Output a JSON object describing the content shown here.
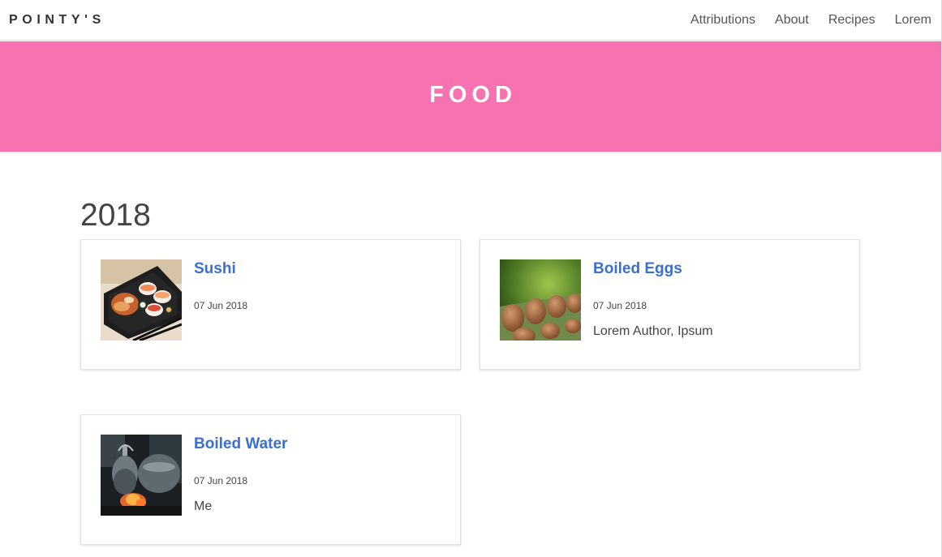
{
  "navbar": {
    "brand": "POINTY'S",
    "links": [
      {
        "label": "Attributions"
      },
      {
        "label": "About"
      },
      {
        "label": "Recipes"
      },
      {
        "label": "Lorem"
      }
    ]
  },
  "hero": {
    "title": "FOOD",
    "background_color": "#f672b1"
  },
  "content": {
    "year": "2018",
    "posts": [
      {
        "title": "Sushi",
        "date": "07 Jun 2018",
        "author": "",
        "image_icon": "sushi-image"
      },
      {
        "title": "Boiled Eggs",
        "date": "07 Jun 2018",
        "author": "Lorem Author, Ipsum",
        "image_icon": "eggs-image"
      },
      {
        "title": "Boiled Water",
        "date": "07 Jun 2018",
        "author": "Me",
        "image_icon": "kettle-image"
      }
    ]
  },
  "colors": {
    "link_blue": "#3b6fd0",
    "text": "#444444"
  }
}
